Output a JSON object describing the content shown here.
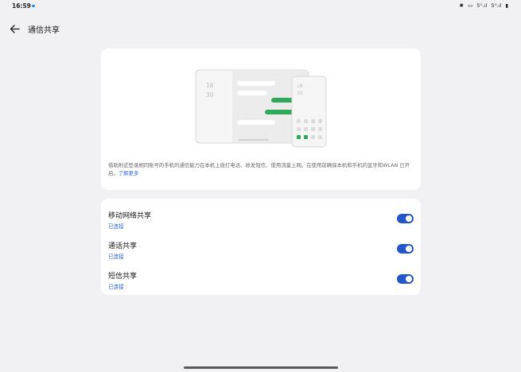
{
  "status_bar": {
    "time": "16:59",
    "right_items": [
      "✱",
      "▭",
      "5ᴳ.ıl",
      "5ᴳ.ıl",
      "▮"
    ]
  },
  "header": {
    "back_icon": "arrow-left-icon",
    "title": "通信共享"
  },
  "illustration": {
    "tablet_clock_hour": "16",
    "tablet_clock_min": "30",
    "phone_clock_hour": "16",
    "phone_clock_min": "30",
    "accent_color": "#2fa85a"
  },
  "description": {
    "text": "借助附近登录相同账号的手机的通信能力在本机上拨打电话、收发短信、使用流量上网。在使用前确保本机和手机的蓝牙和WLAN 已开启。",
    "link": "了解更多"
  },
  "toggles": [
    {
      "title": "移动网络共享",
      "status": "已连接",
      "on": true
    },
    {
      "title": "通话共享",
      "status": "已连接",
      "on": true
    },
    {
      "title": "短信共享",
      "status": "已连接",
      "on": true
    }
  ],
  "colors": {
    "toggle_on": "#2356c8",
    "link": "#2f6bd8",
    "background": "#f1f1f3"
  }
}
